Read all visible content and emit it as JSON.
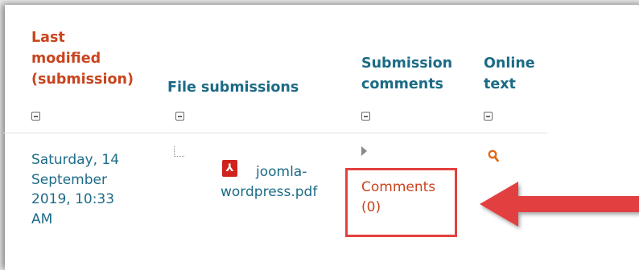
{
  "columns": {
    "last_modified": {
      "lines": [
        "Last",
        "modified",
        "(submission)"
      ]
    },
    "file_submissions": {
      "label": "File submissions"
    },
    "submission_comments": {
      "lines": [
        "Submission",
        "comments"
      ]
    },
    "online_text": {
      "lines": [
        "Online",
        "text"
      ]
    }
  },
  "row": {
    "last_modified_lines": [
      "Saturday, 14",
      "September",
      "2019, 10:33",
      "AM"
    ],
    "file_name_lines": [
      "joomla-",
      "wordpress.pdf"
    ],
    "comments_lines": [
      "Comments",
      "(0)"
    ]
  },
  "colors": {
    "sorted_header": "#c9441d",
    "header_link": "#1c6b86",
    "highlight": "#e2413f",
    "pdf_red": "#d0231e"
  },
  "icons": {
    "collapse": "minus-square-icon",
    "file": "pdf-icon",
    "expand": "triangle-right-icon",
    "online_text": "search-icon",
    "annotation": "arrow-left-icon"
  }
}
